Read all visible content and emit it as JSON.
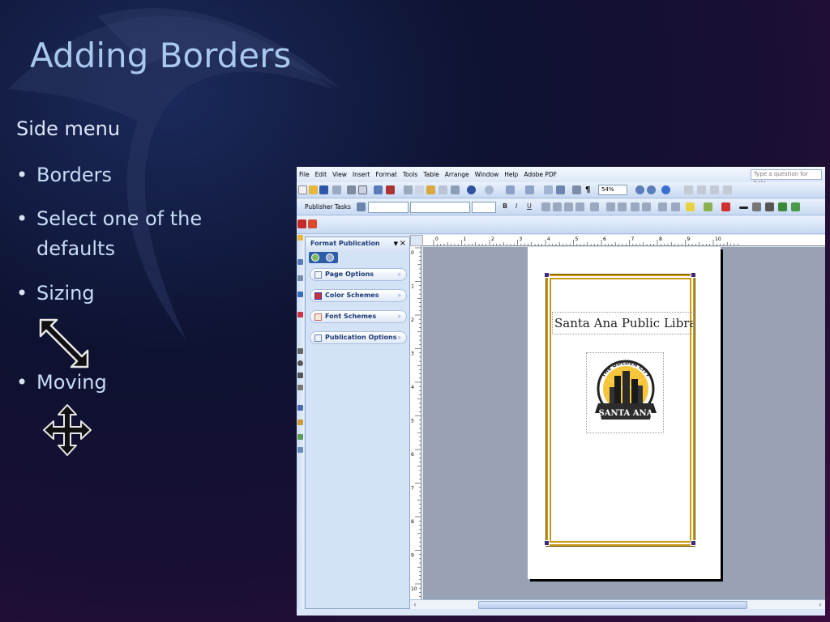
{
  "slide": {
    "title": "Adding Borders",
    "side_menu": "Side menu",
    "bullets": [
      {
        "text": "Borders"
      },
      {
        "text": "Select one of the"
      },
      {
        "text": "defaults"
      },
      {
        "text": "Sizing"
      },
      {
        "text": "Moving"
      }
    ],
    "bullet_char": "•",
    "icons": [
      "resize-diagonal-arrow-icon",
      "move-cross-arrow-icon"
    ]
  },
  "app": {
    "menu": [
      "File",
      "Edit",
      "View",
      "Insert",
      "Format",
      "Tools",
      "Table",
      "Arrange",
      "Window",
      "Help",
      "Adobe PDF"
    ],
    "help_placeholder": "Type a question for help",
    "zoom": "54%",
    "publisher_tasks": "Publisher Tasks",
    "task_pane": {
      "title": "Format Publication",
      "items": [
        "Page Options",
        "Color Schemes",
        "Font Schemes",
        "Publication Options"
      ]
    },
    "document": {
      "text_box": "Santa Ana Public Library",
      "logo_top": "THE GOLDEN CITY",
      "logo_banner": "SANTA ANA"
    },
    "ruler_top": [
      "0",
      "1",
      "2",
      "3",
      "4",
      "5",
      "6",
      "7",
      "8",
      "9",
      "10"
    ],
    "ruler_left": [
      "0",
      "1",
      "2",
      "3",
      "4",
      "5",
      "6",
      "7",
      "8",
      "9",
      "10"
    ],
    "colors": {
      "slide_title": "#a8c8ee",
      "border_gold": "#c89a16",
      "handle": "#3b2a7a",
      "pane_title": "#1b3a75"
    }
  }
}
